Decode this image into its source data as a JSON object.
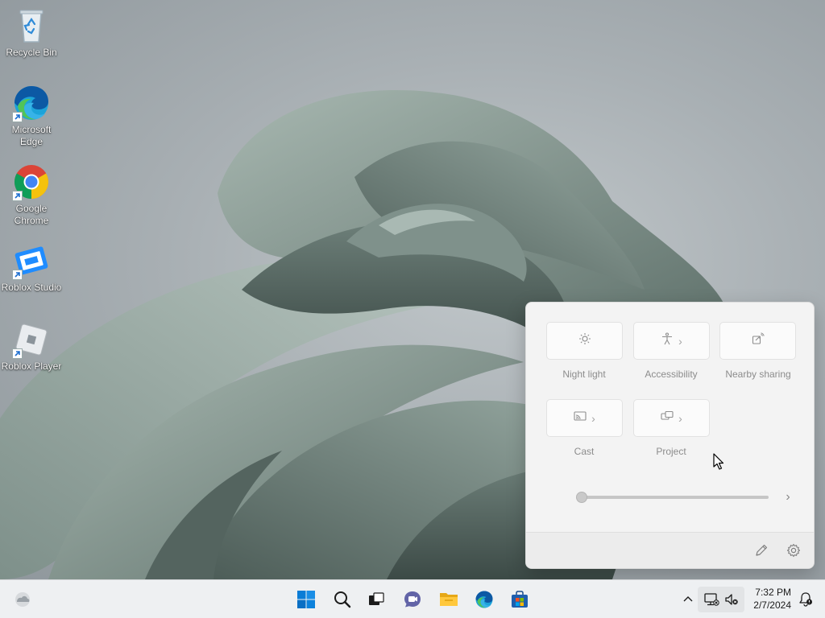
{
  "desktop": {
    "icons": [
      {
        "label": "Recycle Bin",
        "icon": "recycle-bin-icon",
        "shortcut": false
      },
      {
        "label": "Microsoft Edge",
        "icon": "edge-icon",
        "shortcut": true
      },
      {
        "label": "Google Chrome",
        "icon": "chrome-icon",
        "shortcut": true
      },
      {
        "label": "Roblox Studio",
        "icon": "roblox-studio-icon",
        "shortcut": true
      },
      {
        "label": "Roblox Player",
        "icon": "roblox-player-icon",
        "shortcut": true
      }
    ]
  },
  "quick_settings": {
    "tiles": [
      {
        "label": "Night light",
        "icon": "night-light-icon",
        "expandable": false
      },
      {
        "label": "Accessibility",
        "icon": "accessibility-icon",
        "expandable": true
      },
      {
        "label": "Nearby sharing",
        "icon": "nearby-sharing-icon",
        "expandable": false
      },
      {
        "label": "Cast",
        "icon": "cast-icon",
        "expandable": true
      },
      {
        "label": "Project",
        "icon": "project-icon",
        "expandable": true
      }
    ],
    "brightness_slider": {
      "value": 0,
      "disabled": true
    },
    "footer": {
      "edit_icon": "pencil-icon",
      "settings_icon": "gear-icon"
    }
  },
  "taskbar": {
    "widgets_icon": "weather-widget-icon",
    "pinned": [
      {
        "name": "Start",
        "icon": "windows-start-icon"
      },
      {
        "name": "Search",
        "icon": "search-icon"
      },
      {
        "name": "Task View",
        "icon": "task-view-icon"
      },
      {
        "name": "Chat",
        "icon": "teams-chat-icon"
      },
      {
        "name": "File Explorer",
        "icon": "file-explorer-icon"
      },
      {
        "name": "Microsoft Edge",
        "icon": "edge-icon"
      },
      {
        "name": "Microsoft Store",
        "icon": "store-icon"
      }
    ],
    "tray": {
      "overflow_icon": "chevron-up-icon",
      "network_icon": "network-disconnected-icon",
      "volume_icon": "volume-muted-icon",
      "time": "7:32 PM",
      "date": "2/7/2024",
      "notification_icon": "notification-bell-icon"
    }
  },
  "colors": {
    "accent": "#0067c0",
    "taskbar_bg": "#eef0f2",
    "flyout_bg": "#f3f3f3"
  }
}
